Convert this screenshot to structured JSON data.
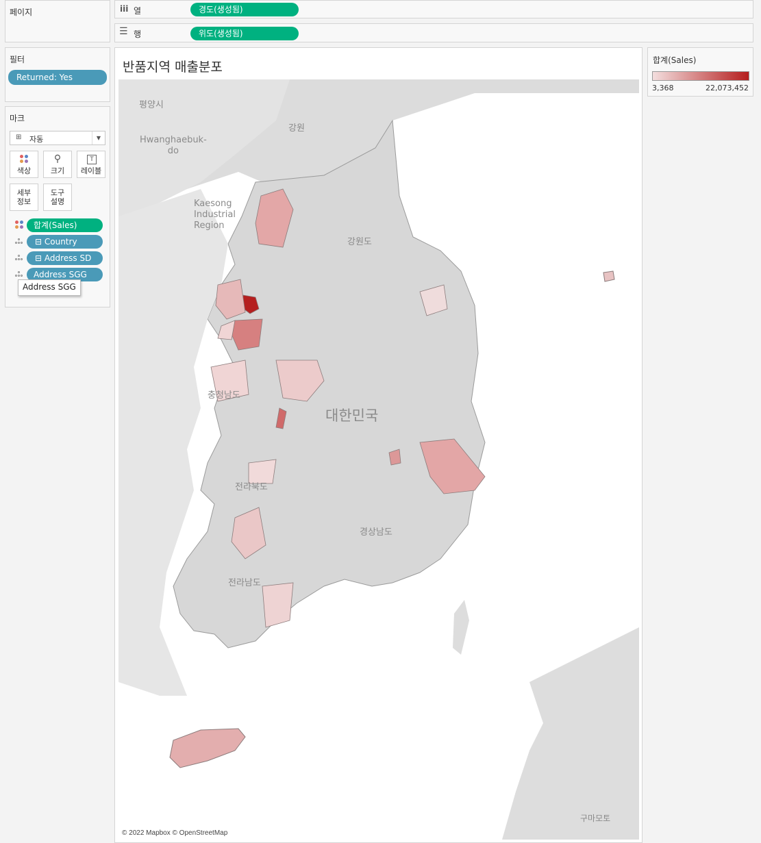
{
  "pages_shelf": {
    "label": "페이지"
  },
  "columns_shelf": {
    "icon": "columns-icon",
    "label": "열",
    "pill": "경도(생성됨)"
  },
  "rows_shelf": {
    "icon": "rows-icon",
    "label": "행",
    "pill": "위도(생성됨)"
  },
  "filters": {
    "label": "필터",
    "items": [
      "Returned: Yes"
    ]
  },
  "marks": {
    "label": "마크",
    "type_icon": "map-icon",
    "type_value": "자동",
    "buttons": [
      {
        "icon": "color-dots-icon",
        "label": "색상"
      },
      {
        "icon": "size-icon",
        "label": "크기"
      },
      {
        "icon": "label-icon",
        "label": "레이블"
      },
      {
        "icon": "",
        "label": "세부\n정보"
      },
      {
        "icon": "",
        "label": "도구\n설명"
      }
    ],
    "fields": [
      {
        "kind": "color",
        "label": "합계(Sales)"
      },
      {
        "kind": "detail",
        "label": "⊟ Country"
      },
      {
        "kind": "detail",
        "label": "⊟ Address SD"
      },
      {
        "kind": "detail",
        "label": "Address SGG"
      }
    ],
    "tooltip": "Address SGG"
  },
  "view": {
    "title": "반품지역 매출분포",
    "attribution": "© 2022 Mapbox © OpenStreetMap",
    "map_labels": {
      "pyongyang": "평양시",
      "gangwon_nk": "강원",
      "hwanghaebuk": "Hwanghaebuk-\ndo",
      "kaesong": "Kaesong\nIndustrial\nRegion",
      "gangwon": "강원도",
      "korea": "대한민국",
      "chungnam": "충청남도",
      "jeonbuk": "전라북도",
      "gyeongnam": "경상남도",
      "jeonnam": "전라남도",
      "kumamoto": "구마모토"
    }
  },
  "legend": {
    "title": "합계(Sales)",
    "min": "3,368",
    "max": "22,073,452",
    "color_low": "#f3dede",
    "color_high": "#b51f1f"
  },
  "chart_data": {
    "type": "heatmap",
    "title": "반품지역 매출분포",
    "color_measure": "합계(Sales)",
    "color_range": [
      3368,
      22073452
    ],
    "regions": []
  }
}
